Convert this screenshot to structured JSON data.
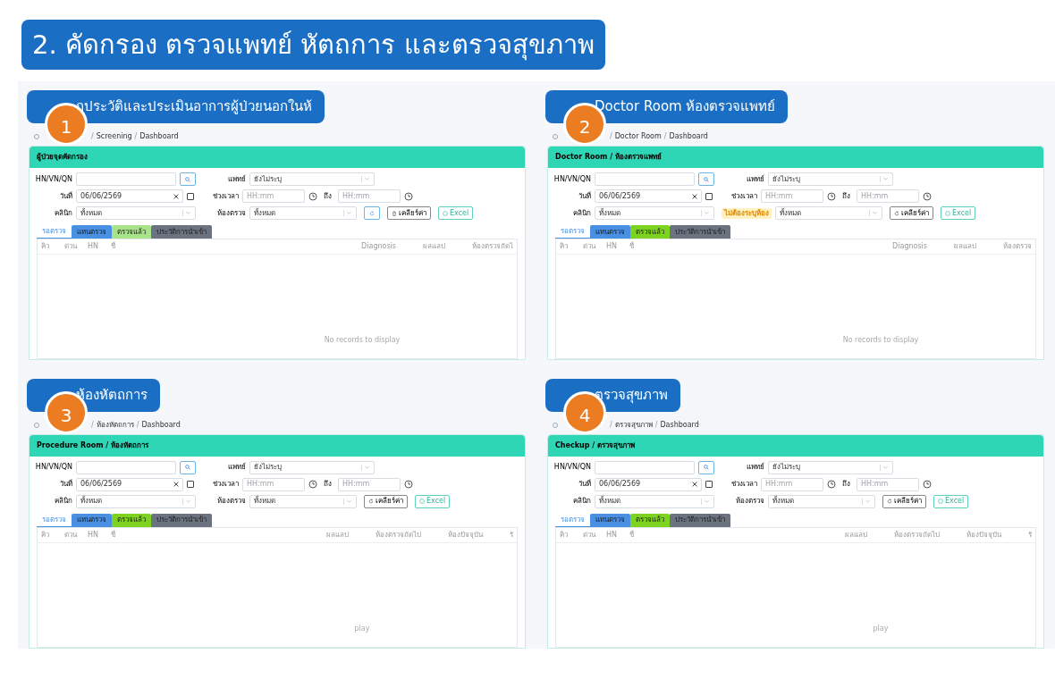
{
  "title": "2. คัดกรอง ตรวจแพทย์ หัตถการ และตรวจสุขภาพ",
  "panels": [
    {
      "number": "1",
      "separator": "/",
      "caption": "กประวัติและประเมินอาการผู้ป่วยนอกในห้",
      "breadcrumb": [
        "Screening",
        "Dashboard"
      ],
      "header": "ผู้ป่วยจุดคัดกรอง",
      "hn_label": "HN/VN/QN",
      "date_label": "วันที่",
      "date_value": "06/06/2569",
      "clinic_label": "คลินิก",
      "clinic_value": "ทั้งหมด",
      "doctor_label": "แพทย์",
      "doctor_value": "ยังไม่ระบุ",
      "time_label": "ช่วงเวลา",
      "time_from": "HH:mm",
      "to_label": "ถึง",
      "time_to": "HH:mm",
      "room": {
        "kind": "label",
        "text": "ห้องตรวจ"
      },
      "room_value": "ทั้งหมด",
      "buttons": [
        {
          "kind": "refresh"
        },
        {
          "kind": "clear",
          "text": "เคลียร์ค่า"
        },
        {
          "kind": "excel",
          "text": "Excel"
        }
      ],
      "tabs": [
        {
          "label": "รอตรวจ",
          "selected": true,
          "color": "#ffffff"
        },
        {
          "label": "แทนตรวจ",
          "selected": false,
          "color": "#4a90e2"
        },
        {
          "label": "ตรวจแล้ว",
          "selected": false,
          "color": "#a8e38a"
        },
        {
          "label": "ประวัติการนำเข้า",
          "selected": false,
          "color": "#6b7280"
        }
      ],
      "columns_left": [
        "คิว",
        "ด่วน",
        "HN",
        "ชื่"
      ],
      "columns_right": [
        "Diagnosis",
        "ผลแลป",
        "ห้องตรวจถัดไ"
      ],
      "empty_text": "No records to display"
    },
    {
      "number": "2",
      "separator": "/",
      "caption": "Doctor Room ห้องตรวจแพทย์",
      "breadcrumb": [
        "Doctor Room",
        "Dashboard"
      ],
      "header": "Doctor Room / ห้องตรวจแพทย์",
      "hn_label": "HN/VN/QN",
      "date_label": "วันที่",
      "date_value": "06/06/2569",
      "clinic_label": "คลินิก",
      "clinic_value": "ทั้งหมด",
      "doctor_label": "แพทย์",
      "doctor_value": "ยังไม่ระบุ",
      "time_label": "ช่วงเวลา",
      "time_from": "HH:mm",
      "to_label": "ถึง",
      "time_to": "HH:mm",
      "room": {
        "kind": "badge",
        "text": "ไม่ต้องระบุห้อง"
      },
      "room_value": "ทั้งหมด",
      "buttons": [
        {
          "kind": "clear",
          "text": "เคลียร์ค่า"
        },
        {
          "kind": "excel",
          "text": "Excel"
        }
      ],
      "tabs": [
        {
          "label": "รอตรวจ",
          "selected": true,
          "color": "#ffffff"
        },
        {
          "label": "แทนตรวจ",
          "selected": false,
          "color": "#4a90e2"
        },
        {
          "label": "ตรวจแล้ว",
          "selected": false,
          "color": "#7ed321"
        },
        {
          "label": "ประวัติการนำเข้า",
          "selected": false,
          "color": "#6b7280"
        }
      ],
      "columns_left": [
        "คิว",
        "ด่วน",
        "HN",
        "ชื่"
      ],
      "columns_right": [
        "Diagnosis",
        "ผลแลป",
        "ห้องตรวจ"
      ],
      "empty_text": "No records to display"
    },
    {
      "number": "3",
      "separator": "/",
      "caption": "ห้องหัตถการ",
      "breadcrumb": [
        "ห้องหัตถการ",
        "Dashboard"
      ],
      "header": "Procedure Room / ห้องหัตถการ",
      "hn_label": "HN/VN/QN",
      "date_label": "วันที่",
      "date_value": "06/06/2569",
      "clinic_label": "คลินิก",
      "clinic_value": "ทั้งหมด",
      "doctor_label": "แพทย์",
      "doctor_value": "ยังไม่ระบุ",
      "time_label": "ช่วงเวลา",
      "time_from": "HH:mm",
      "to_label": "ถึง",
      "time_to": "HH:mm",
      "room": {
        "kind": "label",
        "text": "ห้องตรวจ"
      },
      "room_value": "ทั้งหมด",
      "buttons": [
        {
          "kind": "clear",
          "text": "เคลียร์ค่า"
        },
        {
          "kind": "excel",
          "text": "Excel"
        }
      ],
      "tabs": [
        {
          "label": "รอตรวจ",
          "selected": true,
          "color": "#ffffff"
        },
        {
          "label": "แทนตรวจ",
          "selected": false,
          "color": "#4a90e2"
        },
        {
          "label": "ตรวจแล้ว",
          "selected": false,
          "color": "#7ed321"
        },
        {
          "label": "ประวัติการนำเข้า",
          "selected": false,
          "color": "#6b7280"
        }
      ],
      "columns_left": [
        "คิว",
        "ด่วน",
        "HN",
        "ชื่"
      ],
      "columns_right": [
        "ผลแลป",
        "ห้องตรวจถัดไป",
        "ห้องปัจจุบัน",
        "รั"
      ],
      "empty_text": "play"
    },
    {
      "number": "4",
      "separator": "/",
      "caption": "ตรวจสุขภาพ",
      "breadcrumb": [
        "ตรวจสุขภาพ",
        "Dashboard"
      ],
      "header": "Checkup / ตรวจสุขภาพ",
      "hn_label": "HN/VN/QN",
      "date_label": "วันที่",
      "date_value": "06/06/2569",
      "clinic_label": "คลินิก",
      "clinic_value": "ทั้งหมด",
      "doctor_label": "แพทย์",
      "doctor_value": "ยังไม่ระบุ",
      "time_label": "ช่วงเวลา",
      "time_from": "HH:mm",
      "to_label": "ถึง",
      "time_to": "HH:mm",
      "room": {
        "kind": "label",
        "text": "ห้องตรวจ"
      },
      "room_value": "ทั้งหมด",
      "buttons": [
        {
          "kind": "clear",
          "text": "เคลียร์ค่า"
        },
        {
          "kind": "excel",
          "text": "Excel"
        }
      ],
      "tabs": [
        {
          "label": "รอตรวจ",
          "selected": true,
          "color": "#ffffff"
        },
        {
          "label": "แทนตรวจ",
          "selected": false,
          "color": "#4a90e2"
        },
        {
          "label": "ตรวจแล้ว",
          "selected": false,
          "color": "#7ed321"
        },
        {
          "label": "ประวัติการนำเข้า",
          "selected": false,
          "color": "#6b7280"
        }
      ],
      "columns_left": [
        "คิว",
        "ด่วน",
        "HN",
        "ชื่"
      ],
      "columns_right": [
        "ผลแลป",
        "ห้องตรวจถัดไป",
        "ห้องปัจจุบัน",
        "รั"
      ],
      "empty_text": "play"
    }
  ]
}
